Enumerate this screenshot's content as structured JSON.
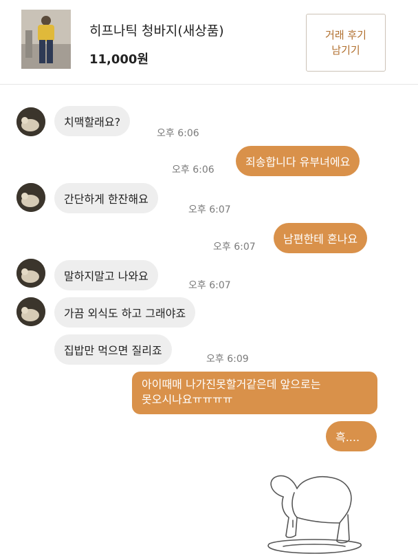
{
  "product": {
    "title": "히프나틱 청바지(새상품)",
    "price": "11,000원",
    "review_button_label": "거래 후기\n남기기"
  },
  "messages": [
    {
      "side": "in",
      "text": "치맥할래요?",
      "time": "오후 6:06"
    },
    {
      "side": "out",
      "text": "죄송합니다 유부녀에요",
      "time": "오후 6:06"
    },
    {
      "side": "in",
      "text": "간단하게 한잔해요",
      "time": "오후 6:07"
    },
    {
      "side": "out",
      "text": "남편한테 혼나요",
      "time": "오후 6:07"
    },
    {
      "side": "in",
      "text": "말하지말고 나와요",
      "time": "오후 6:07"
    },
    {
      "side": "in",
      "text": "가끔 외식도 하고 그래야죠",
      "time": ""
    },
    {
      "side": "in",
      "text": "집밥만 먹으면 질리죠",
      "time": "오후 6:09"
    },
    {
      "side": "out",
      "text": "아이때매 나가진못할거같은데 앞으로는\n못오시나요ㅠㅠㅠㅠ",
      "time": ""
    },
    {
      "side": "out",
      "text": "흑....",
      "time": ""
    }
  ],
  "icons": {
    "product_thumbnail": "product-photo",
    "avatar": "user-avatar",
    "sticker": "crying-rabbit-sticker"
  }
}
